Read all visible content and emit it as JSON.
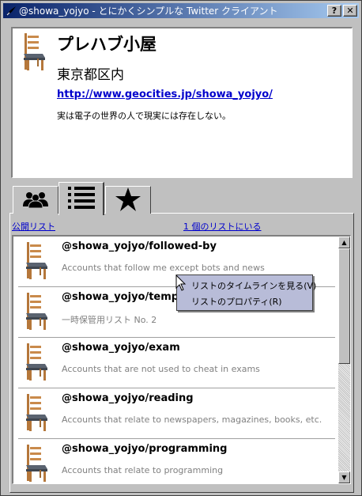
{
  "window": {
    "title": "@showa_yojyo - とにかくシンプルな Twitter クライアント",
    "help_label": "?",
    "close_label": "✕"
  },
  "profile": {
    "name": "プレハブ小屋",
    "location": "東京都区内",
    "url": "http://www.geocities.jp/showa_yojyo/",
    "bio": "実は電子の世界の人で現実には存在しない。",
    "avatar_icon": "chair-icon"
  },
  "tabs": [
    {
      "name": "tab-users",
      "icon": "users-icon"
    },
    {
      "name": "tab-lists",
      "icon": "list-icon",
      "selected": true
    },
    {
      "name": "tab-favorites",
      "icon": "star-icon"
    }
  ],
  "links": {
    "public_lists": "公開リスト",
    "member_count": "1 個のリストにいる"
  },
  "lists": [
    {
      "name": "@showa_yojyo/followed-by",
      "description": "Accounts that follow me except bots and news"
    },
    {
      "name": "@showa_yojyo/temp2",
      "description": "一時保管用リスト No. 2"
    },
    {
      "name": "@showa_yojyo/exam",
      "description": "Accounts that are not used to cheat in exams"
    },
    {
      "name": "@showa_yojyo/reading",
      "description": "Accounts that relate to newspapers, magazines, books, etc."
    },
    {
      "name": "@showa_yojyo/programming",
      "description": "Accounts that relate to programming"
    }
  ],
  "context_menu": {
    "items": [
      "リストのタイムラインを見る(V)",
      "リストのプロパティ(R)"
    ]
  },
  "colors": {
    "titlebar_start": "#0a246a",
    "titlebar_end": "#a6caf0",
    "link": "#0000cc",
    "menu_bg": "#b8bcd8"
  }
}
